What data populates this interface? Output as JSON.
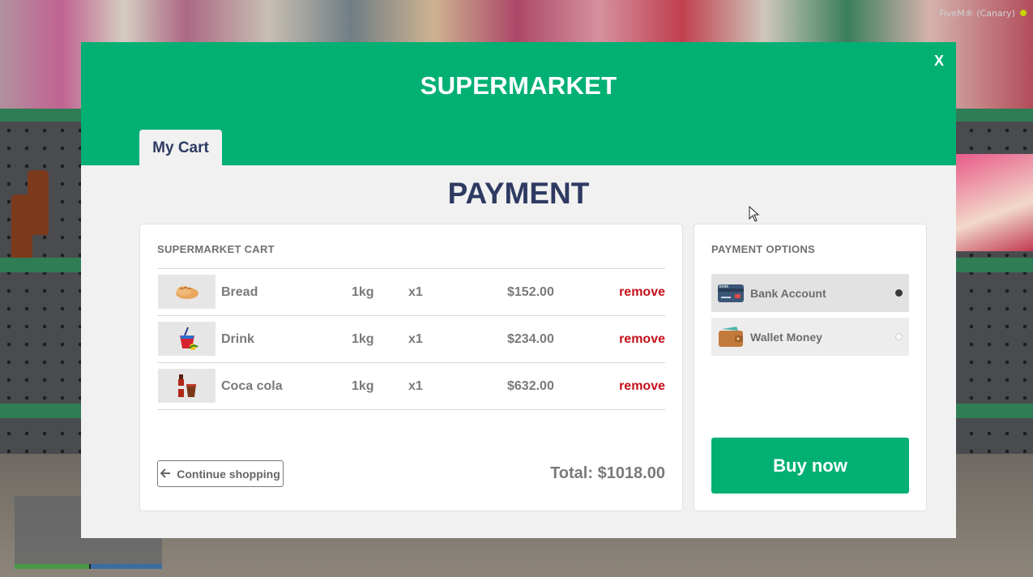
{
  "overlay": {
    "client_label": "FiveM® (Canary)"
  },
  "header": {
    "title": "SUPERMARKET",
    "close_label": "X"
  },
  "tabs": [
    {
      "label": "My Cart",
      "active": true
    }
  ],
  "page": {
    "heading": "PAYMENT"
  },
  "cart": {
    "title": "SUPERMARKET CART",
    "items": [
      {
        "icon": "bread-icon",
        "name": "Bread",
        "unit": "1kg",
        "qty": "x1",
        "price": "$152.00",
        "remove_label": "remove"
      },
      {
        "icon": "drink-icon",
        "name": "Drink",
        "unit": "1kg",
        "qty": "x1",
        "price": "$234.00",
        "remove_label": "remove"
      },
      {
        "icon": "coca-cola-icon",
        "name": "Coca cola",
        "unit": "1kg",
        "qty": "x1",
        "price": "$632.00",
        "remove_label": "remove"
      }
    ],
    "continue_label": "Continue shopping",
    "total": "Total: $1018.00"
  },
  "payment": {
    "title": "PAYMENT OPTIONS",
    "options": [
      {
        "icon": "bank-card-icon",
        "label": "Bank Account",
        "selected": true
      },
      {
        "icon": "wallet-icon",
        "label": "Wallet Money",
        "selected": false
      }
    ],
    "buy_label": "Buy now"
  },
  "colors": {
    "accent": "#02b073",
    "heading": "#2e3a62",
    "remove": "#c4111a"
  }
}
